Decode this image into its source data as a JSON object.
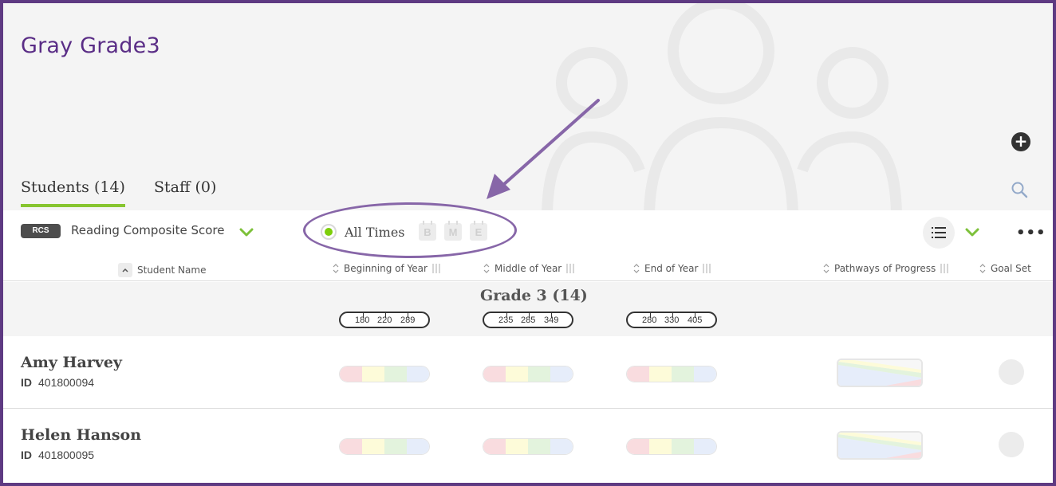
{
  "class": {
    "title": "Gray Grade3"
  },
  "tabs": [
    {
      "label": "Students (14)",
      "active": true
    },
    {
      "label": "Staff (0)",
      "active": false
    }
  ],
  "toolbar": {
    "measure_badge": "RCS",
    "measure_label": "Reading Composite Score",
    "time_filter_label": "All Times",
    "periods": [
      "B",
      "M",
      "E"
    ]
  },
  "columns": {
    "student_name": "Student Name",
    "boy": "Beginning of Year",
    "moy": "Middle of Year",
    "eoy": "End of Year",
    "pathways": "Pathways of Progress",
    "goal": "Goal Set"
  },
  "grade_group": {
    "title": "Grade 3 (14)",
    "boy_ranges": [
      "180",
      "220",
      "289"
    ],
    "moy_ranges": [
      "235",
      "285",
      "349"
    ],
    "eoy_ranges": [
      "280",
      "330",
      "405"
    ]
  },
  "students": [
    {
      "name": "Amy Harvey",
      "id_label": "ID",
      "id": "401800094"
    },
    {
      "name": "Helen Hanson",
      "id_label": "ID",
      "id": "401800095"
    }
  ],
  "colors": {
    "border": "#5e3a82",
    "title": "#5a2d86",
    "accent_green": "#87c530",
    "annotation": "#8766a8",
    "bar_red": "#f9dcdf",
    "bar_yellow": "#fdfbd9",
    "bar_green": "#e3f3dd",
    "bar_blue": "#e6edfa"
  },
  "icons": {
    "add": "plus-circle-icon",
    "search": "search-icon",
    "chevron": "chevron-down-icon",
    "list_view": "list-icon",
    "more": "more-horizontal-icon",
    "background": "people-group-icon"
  }
}
